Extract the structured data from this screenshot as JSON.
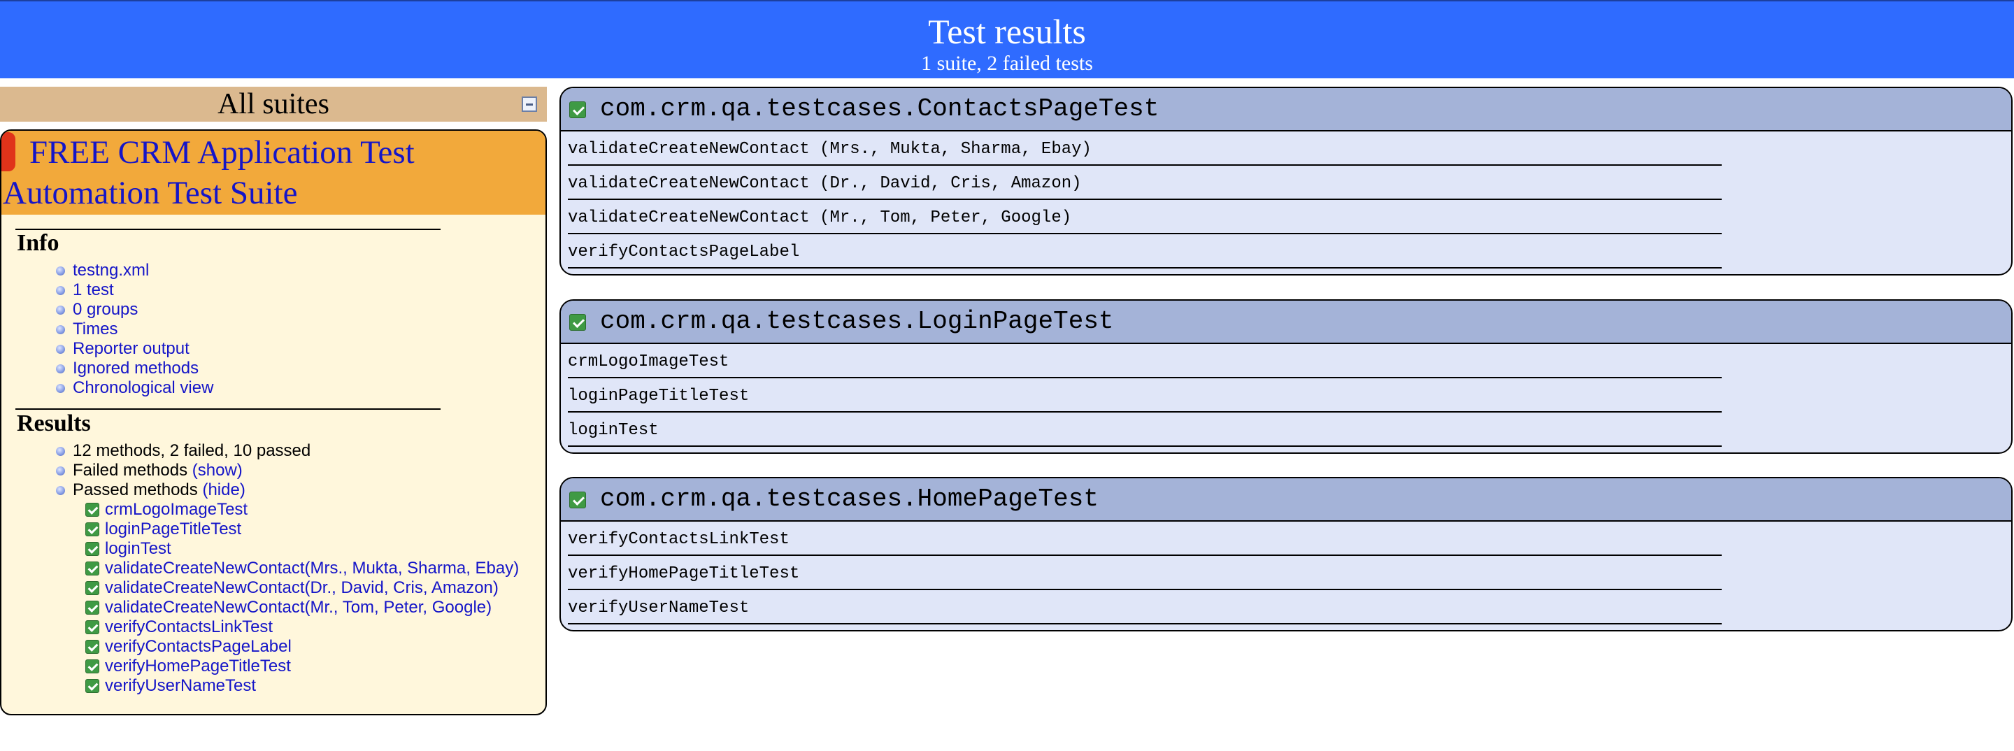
{
  "header": {
    "title": "Test results",
    "subtitle": "1 suite, 2 failed tests"
  },
  "left": {
    "all_suites_label": "All suites",
    "suite": {
      "name_line1": "FREE CRM Application Test",
      "name_line2": "Automation Test Suite"
    },
    "info": {
      "title": "Info",
      "links": [
        "testng.xml",
        "1 test",
        "0 groups",
        "Times",
        "Reporter output",
        "Ignored methods",
        "Chronological view"
      ]
    },
    "results": {
      "title": "Results",
      "summary": "12 methods, 2 failed, 10 passed",
      "failed_label": "Failed methods",
      "failed_toggle": "(show)",
      "passed_label": "Passed methods",
      "passed_toggle": "(hide)",
      "passed_methods": [
        "crmLogoImageTest",
        "loginPageTitleTest",
        "loginTest",
        "validateCreateNewContact(Mrs., Mukta, Sharma, Ebay)",
        "validateCreateNewContact(Dr., David, Cris, Amazon)",
        "validateCreateNewContact(Mr., Tom, Peter, Google)",
        "verifyContactsLinkTest",
        "verifyContactsPageLabel",
        "verifyHomePageTitleTest",
        "verifyUserNameTest"
      ]
    }
  },
  "classes": [
    {
      "name": "com.crm.qa.testcases.ContactsPageTest",
      "methods": [
        "validateCreateNewContact (Mrs., Mukta, Sharma, Ebay)",
        "validateCreateNewContact (Dr., David, Cris, Amazon)",
        "validateCreateNewContact (Mr., Tom, Peter, Google)",
        "verifyContactsPageLabel"
      ]
    },
    {
      "name": "com.crm.qa.testcases.LoginPageTest",
      "methods": [
        "crmLogoImageTest",
        "loginPageTitleTest",
        "loginTest"
      ]
    },
    {
      "name": "com.crm.qa.testcases.HomePageTest",
      "methods": [
        "verifyContactsLinkTest",
        "verifyHomePageTitleTest",
        "verifyUserNameTest"
      ]
    }
  ],
  "icons": {
    "check": "check-icon",
    "bullet": "bullet-icon",
    "collapse": "collapse-icon"
  },
  "colors": {
    "header_bg": "#2f6bff",
    "suites_bar": "#dbb98f",
    "suite_header": "#f2a93b",
    "suite_panel": "#fff7dc",
    "class_header": "#a4b3d8",
    "class_body": "#e0e6f8",
    "pass_green": "#3f9a44",
    "link_blue": "#1515c8"
  }
}
